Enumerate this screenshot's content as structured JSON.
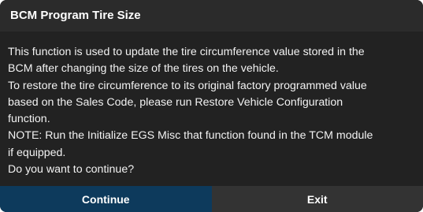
{
  "dialog": {
    "title": "BCM Program Tire Size",
    "lines": [
      "This function is used to update the tire circumference value stored in the",
      "BCM after changing the size of the tires on the vehicle.",
      "To restore the tire circumference to its original factory programmed value",
      "based on the Sales Code, please run Restore Vehicle Configuration",
      "function.",
      "NOTE: Run the Initialize EGS Misc that function found in the TCM module",
      "if equipped.",
      "Do you want to continue?"
    ],
    "buttons": {
      "continue_label": "Continue",
      "exit_label": "Exit"
    }
  },
  "colors": {
    "background": "#1f1f1f",
    "title_bar": "#2b2b2b",
    "continue_button": "#0d3a5c",
    "exit_button": "#333333",
    "text": "#ffffff"
  }
}
